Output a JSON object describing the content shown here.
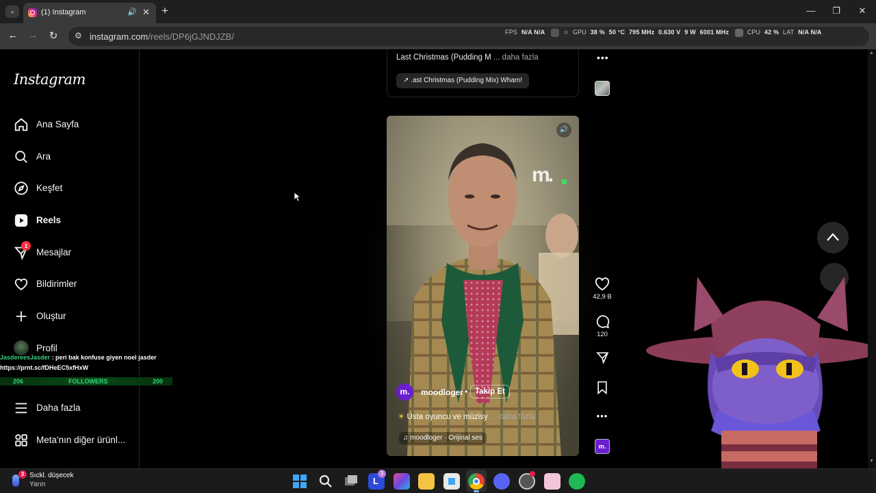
{
  "browser": {
    "tab_list_glyph": "⌄",
    "tab_title": "(1) Instagram",
    "tab_audio_icon": "speaker-icon",
    "tab_close_glyph": "✕",
    "new_tab_glyph": "+",
    "window_controls": [
      "—",
      "❐",
      "✕"
    ],
    "back_glyph": "←",
    "forward_glyph": "→",
    "reload_glyph": "↻",
    "site_info_glyph": "⚙",
    "url_host": "instagram.com",
    "url_path": "/reels/DP6jGJNDJZB/"
  },
  "overlay_stats": {
    "fps_label": "FPS",
    "fps_values": "N/A  N/A",
    "gpu_label": "GPU",
    "gpu_load": "38 %",
    "gpu_temp": "50 °C",
    "gpu_clock": "795 MHz",
    "gpu_voltage": "0.630 V",
    "gpu_power": "9 W",
    "mem_clock": "6001 MHz",
    "cpu_label": "CPU",
    "cpu_load": "42 %",
    "lat_label": "LAT",
    "lat_values": "N/A  N/A"
  },
  "instagram": {
    "logo": "Instagram",
    "nav": [
      {
        "label": "Ana Sayfa",
        "icon": "home-icon"
      },
      {
        "label": "Ara",
        "icon": "search-icon"
      },
      {
        "label": "Keşfet",
        "icon": "compass-icon"
      },
      {
        "label": "Reels",
        "icon": "reels-icon"
      },
      {
        "label": "Mesajlar",
        "icon": "messenger-icon",
        "badge": "1"
      },
      {
        "label": "Bildirimler",
        "icon": "heart-icon"
      },
      {
        "label": "Oluştur",
        "icon": "plus-icon"
      },
      {
        "label": "Profil",
        "icon": "avatar"
      },
      {
        "label": "Daha fazla",
        "icon": "menu-icon"
      },
      {
        "label": "Meta'nın diğer ürünl...",
        "icon": "apps-icon"
      }
    ]
  },
  "stream_overlay": {
    "chat_user": "JasdereesJasder",
    "chat_message": " : peri bak konfuse giyen noel jasder",
    "chat_link": "https://prnt.sc/fDHeEC5xfHxW",
    "followers_left": "206",
    "followers_label": "FOLLOWERS",
    "followers_right": "200"
  },
  "previous_reel": {
    "caption": "Last Christmas (Pudding M",
    "more": " ... daha fazla",
    "music": ".ast Christmas (Pudding Mix)  Wham!",
    "music_icon": "↗"
  },
  "reel": {
    "watermark": "m.",
    "author_avatar": "m.",
    "author": "moodloger",
    "separator": "•",
    "follow_label": "Takip Et",
    "caption": "Usta oyuncu ve müzisy",
    "caption_more": " ... daha fazla",
    "caption_icon": "☀",
    "music_icon": "♫",
    "music": "moodloger · Orijinal ses",
    "likes": "42,9 B",
    "comments": "120",
    "more_glyph": "•••"
  },
  "taskbar": {
    "weather_title": "Sıckl. düşecek",
    "weather_sub": "Yarın",
    "weather_badge": "3",
    "ldplayer_badge": "3"
  }
}
